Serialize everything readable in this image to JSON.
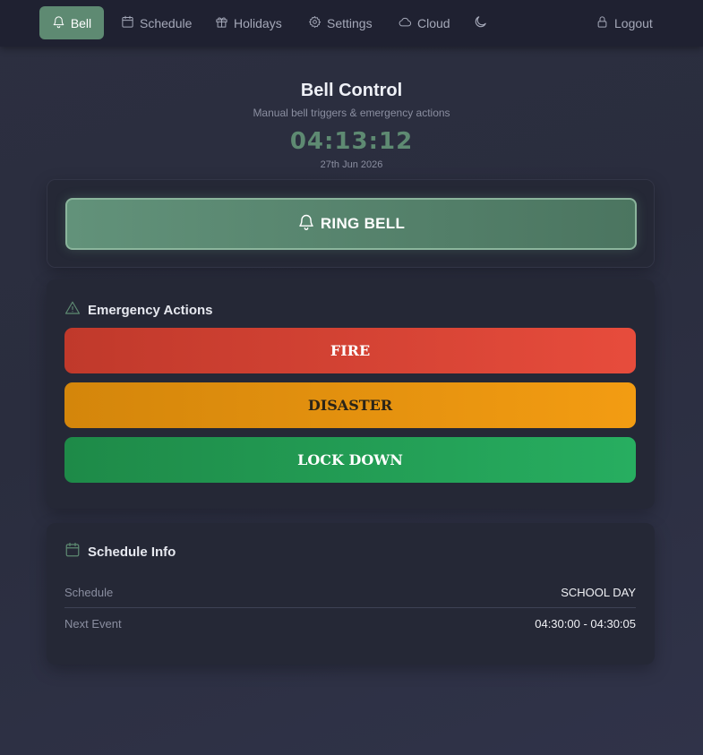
{
  "nav": {
    "bell": "Bell",
    "schedule": "Schedule",
    "holidays": "Holidays",
    "settings": "Settings",
    "cloud": "Cloud",
    "logout": "Logout",
    "active_color": "#5e8a72"
  },
  "header": {
    "title": "Bell Control",
    "subtitle": "Manual bell triggers & emergency actions",
    "time": "04:13:12",
    "date": "27th Jun 2026"
  },
  "ring": {
    "label": "RING BELL"
  },
  "emergency": {
    "heading": "Emergency Actions",
    "fire": "FIRE",
    "disaster": "DISASTER",
    "lockdown": "LOCK DOWN",
    "colors": {
      "fire": "#e74c3c",
      "disaster": "#f39c12",
      "lockdown": "#27ae60"
    }
  },
  "schedule_info": {
    "heading": "Schedule Info",
    "rows": [
      {
        "label": "Schedule",
        "value": "SCHOOL DAY"
      },
      {
        "label": "Next Event",
        "value": "04:30:00 - 04:30:05"
      }
    ]
  },
  "icons": [
    "bell-icon",
    "calendar-icon",
    "gift-icon",
    "gear-icon",
    "cloud-icon",
    "moon-icon",
    "lock-icon",
    "warning-icon"
  ]
}
